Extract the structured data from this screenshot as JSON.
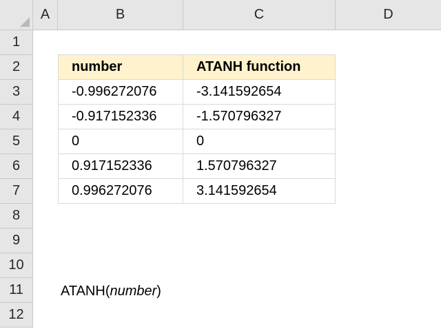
{
  "columns": [
    "A",
    "B",
    "C",
    "D"
  ],
  "rows": [
    "1",
    "2",
    "3",
    "4",
    "5",
    "6",
    "7",
    "8",
    "9",
    "10",
    "11",
    "12"
  ],
  "table": {
    "headers": [
      "number",
      "ATANH function"
    ],
    "rows": [
      [
        "-0.996272076",
        "-3.141592654"
      ],
      [
        "-0.917152336",
        "-1.570796327"
      ],
      [
        "0",
        "0"
      ],
      [
        "0.917152336",
        "1.570796327"
      ],
      [
        "0.996272076",
        "3.141592654"
      ]
    ]
  },
  "syntax": {
    "func": "ATANH(",
    "arg": "number",
    "close": " )"
  }
}
